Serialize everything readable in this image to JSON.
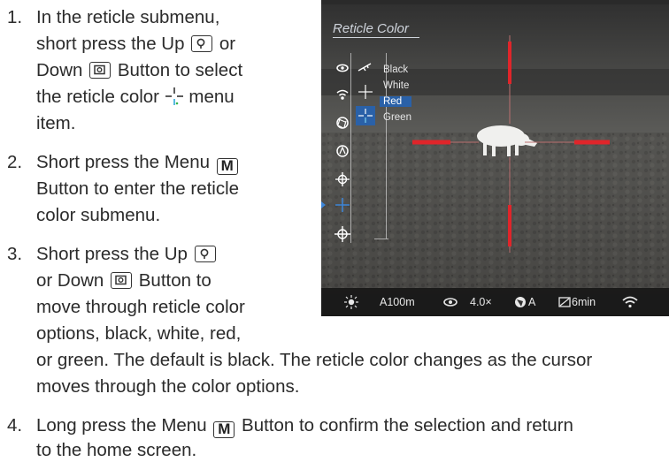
{
  "steps": [
    {
      "number": "1.",
      "lines": [
        "In the reticle submenu,",
        "short press the Up",
        "or",
        "Down",
        "Button to select",
        "the reticle color",
        "menu",
        "item."
      ]
    },
    {
      "number": "2.",
      "lines": [
        "Short press the Menu",
        "Button to enter the reticle",
        "color submenu."
      ]
    },
    {
      "number": "3.",
      "lines": [
        "Short press the Up",
        "or Down",
        "Button to",
        "move through reticle color",
        "options, black, white, red,",
        "or green. The default is black. The reticle color changes as the cursor",
        "moves through the color options."
      ]
    },
    {
      "number": "4.",
      "lines": [
        "Long press the Menu",
        "Button to confirm the selection and return",
        "to the home screen."
      ]
    }
  ],
  "keys": {
    "menu_key": "M"
  },
  "screen": {
    "menu_title": "Reticle Color",
    "colors": [
      "Black",
      "White",
      "Red",
      "Green"
    ],
    "selected_color": "Red",
    "status": {
      "distance": "A100m",
      "zoom": "4.0×",
      "mode": "A",
      "timer": "6min"
    }
  },
  "colors": {
    "reticle_red": "#e0252a",
    "menu_highlight": "#2a61a8",
    "text": "#2b2b2b"
  }
}
